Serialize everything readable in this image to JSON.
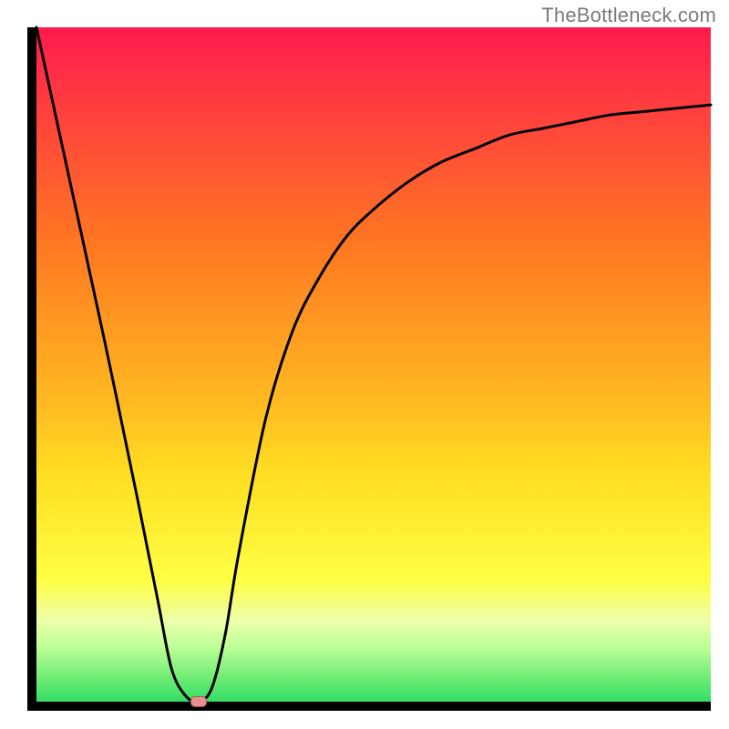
{
  "watermark": "TheBottleneck.com",
  "chart_data": {
    "type": "line",
    "title": "",
    "xlabel": "",
    "ylabel": "",
    "xlim": [
      0,
      100
    ],
    "ylim": [
      0,
      100
    ],
    "background_gradient": {
      "top": "#ff1a4d",
      "bottom": "#33dd66",
      "description": "vertical red-to-green gradient (red=high bottleneck, green=low bottleneck)"
    },
    "series": [
      {
        "name": "bottleneck-curve",
        "color": "#000000",
        "x": [
          0,
          5,
          10,
          15,
          18,
          20,
          22,
          24,
          26,
          28,
          30,
          34,
          38,
          42,
          46,
          50,
          55,
          60,
          65,
          70,
          75,
          80,
          85,
          90,
          95,
          100
        ],
        "y": [
          100,
          77,
          54,
          30,
          15,
          5,
          1,
          0,
          2,
          10,
          22,
          42,
          55,
          63,
          69,
          73,
          77,
          80,
          82,
          84,
          85,
          86,
          87,
          87.5,
          88,
          88.5
        ]
      }
    ],
    "marker": {
      "name": "optimal-point",
      "x": 24,
      "y": 0,
      "color": "#e89090"
    },
    "grid": false,
    "legend": false
  }
}
